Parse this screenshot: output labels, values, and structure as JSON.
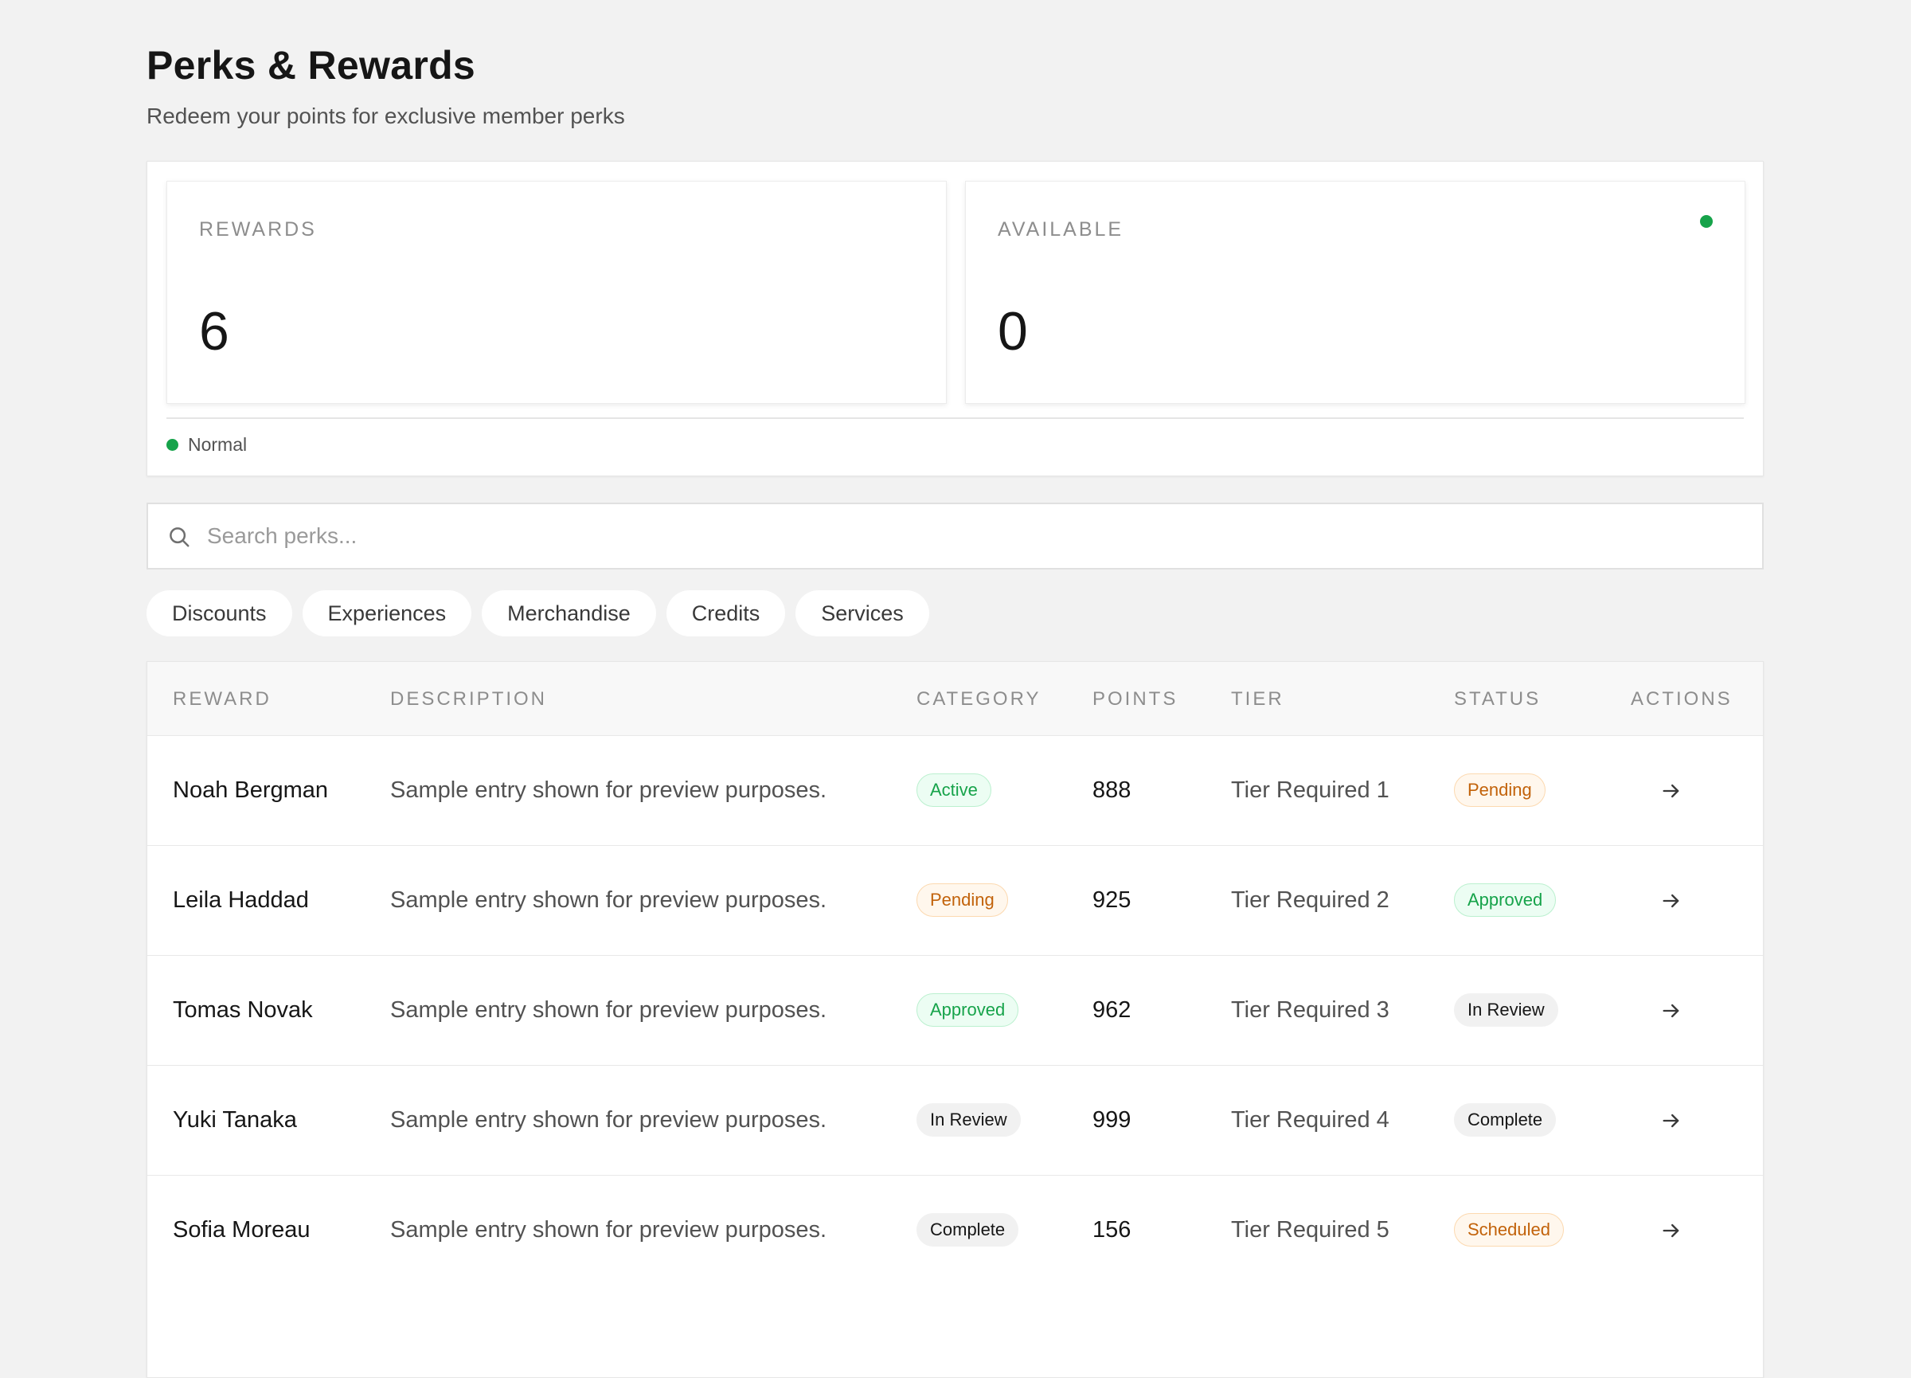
{
  "page": {
    "title": "Perks & Rewards",
    "subtitle": "Redeem your points for exclusive member perks"
  },
  "stats": {
    "rewards": {
      "label": "REWARDS",
      "value": "6"
    },
    "available": {
      "label": "AVAILABLE",
      "value": "0",
      "indicator_color": "#16a34a"
    },
    "status": {
      "label": "Normal",
      "color": "#16a34a"
    }
  },
  "search": {
    "placeholder": "Search perks...",
    "value": ""
  },
  "filters": [
    "Discounts",
    "Experiences",
    "Merchandise",
    "Credits",
    "Services"
  ],
  "table": {
    "columns": [
      "REWARD",
      "DESCRIPTION",
      "CATEGORY",
      "POINTS",
      "TIER",
      "STATUS",
      "ACTIONS"
    ],
    "rows": [
      {
        "reward": "Noah Bergman",
        "description": "Sample entry shown for preview purposes.",
        "category": "Active",
        "points": "888",
        "tier": "Tier Required 1",
        "status": "Pending"
      },
      {
        "reward": "Leila Haddad",
        "description": "Sample entry shown for preview purposes.",
        "category": "Pending",
        "points": "925",
        "tier": "Tier Required 2",
        "status": "Approved"
      },
      {
        "reward": "Tomas Novak",
        "description": "Sample entry shown for preview purposes.",
        "category": "Approved",
        "points": "962",
        "tier": "Tier Required 3",
        "status": "In Review"
      },
      {
        "reward": "Yuki Tanaka",
        "description": "Sample entry shown for preview purposes.",
        "category": "In Review",
        "points": "999",
        "tier": "Tier Required 4",
        "status": "Complete"
      },
      {
        "reward": "Sofia Moreau",
        "description": "Sample entry shown for preview purposes.",
        "category": "Complete",
        "points": "156",
        "tier": "Tier Required 5",
        "status": "Scheduled"
      }
    ]
  },
  "colors": {
    "success": "#16a34a",
    "warning": "#c2620a",
    "background": "#f2f2f2"
  },
  "icons": {
    "search": "search-icon",
    "row_action": "arrow-right-icon"
  }
}
